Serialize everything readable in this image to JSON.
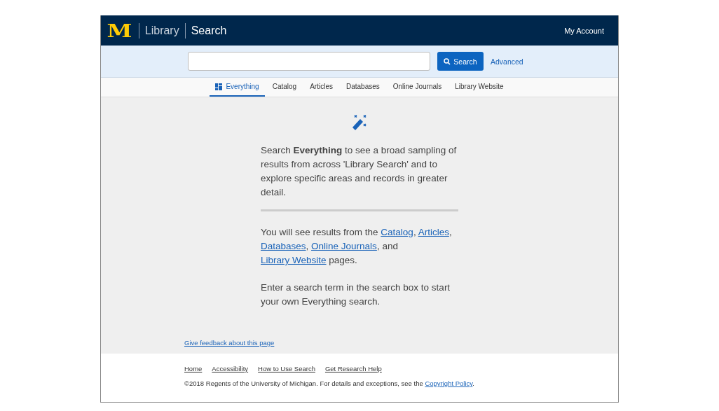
{
  "header": {
    "logo": "M",
    "library": "Library",
    "title": "Search",
    "account": "My Account"
  },
  "search": {
    "button": "Search",
    "advanced": "Advanced"
  },
  "tabs": [
    {
      "label": "Everything",
      "selected": true,
      "icon": true
    },
    {
      "label": "Catalog",
      "selected": false
    },
    {
      "label": "Articles",
      "selected": false
    },
    {
      "label": "Databases",
      "selected": false
    },
    {
      "label": "Online Journals",
      "selected": false
    },
    {
      "label": "Library Website",
      "selected": false
    }
  ],
  "intro": "Search **Everything** to see a broad sampling of results from across 'Library Search' and to explore specific areas and records in greater detail.",
  "results_note": [
    {
      "kind": "text",
      "text": "You will see results from the "
    },
    {
      "kind": "link",
      "text": "Catalog"
    },
    {
      "kind": "text",
      "text": ", "
    },
    {
      "kind": "link",
      "text": "Articles"
    },
    {
      "kind": "text",
      "text": ", "
    },
    {
      "kind": "link",
      "text": "Databases"
    },
    {
      "kind": "text",
      "text": ", "
    },
    {
      "kind": "link",
      "text": "Online Journals"
    },
    {
      "kind": "text",
      "text": ", and "
    },
    {
      "kind": "link",
      "text": "Library Website"
    },
    {
      "kind": "text",
      "text": " pages."
    }
  ],
  "hint": "Enter a search term in the search box to start your own Everything search.",
  "feedback": "Give feedback about this page",
  "footer_links": [
    "Home",
    "Accessibility",
    "How to Use Search",
    "Get Research Help"
  ],
  "copyright": [
    {
      "kind": "text",
      "text": "©2018 Regents of the University of Michigan. For details and exceptions, see the "
    },
    {
      "kind": "link",
      "text": "Copyright Policy"
    },
    {
      "kind": "text",
      "text": "."
    }
  ]
}
